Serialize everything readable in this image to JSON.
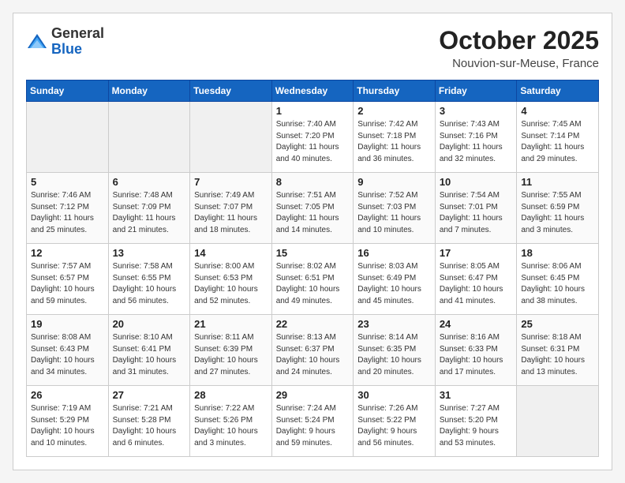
{
  "header": {
    "logo_general": "General",
    "logo_blue": "Blue",
    "month_title": "October 2025",
    "location": "Nouvion-sur-Meuse, France"
  },
  "weekdays": [
    "Sunday",
    "Monday",
    "Tuesday",
    "Wednesday",
    "Thursday",
    "Friday",
    "Saturday"
  ],
  "weeks": [
    [
      {
        "day": "",
        "info": ""
      },
      {
        "day": "",
        "info": ""
      },
      {
        "day": "",
        "info": ""
      },
      {
        "day": "1",
        "info": "Sunrise: 7:40 AM\nSunset: 7:20 PM\nDaylight: 11 hours\nand 40 minutes."
      },
      {
        "day": "2",
        "info": "Sunrise: 7:42 AM\nSunset: 7:18 PM\nDaylight: 11 hours\nand 36 minutes."
      },
      {
        "day": "3",
        "info": "Sunrise: 7:43 AM\nSunset: 7:16 PM\nDaylight: 11 hours\nand 32 minutes."
      },
      {
        "day": "4",
        "info": "Sunrise: 7:45 AM\nSunset: 7:14 PM\nDaylight: 11 hours\nand 29 minutes."
      }
    ],
    [
      {
        "day": "5",
        "info": "Sunrise: 7:46 AM\nSunset: 7:12 PM\nDaylight: 11 hours\nand 25 minutes."
      },
      {
        "day": "6",
        "info": "Sunrise: 7:48 AM\nSunset: 7:09 PM\nDaylight: 11 hours\nand 21 minutes."
      },
      {
        "day": "7",
        "info": "Sunrise: 7:49 AM\nSunset: 7:07 PM\nDaylight: 11 hours\nand 18 minutes."
      },
      {
        "day": "8",
        "info": "Sunrise: 7:51 AM\nSunset: 7:05 PM\nDaylight: 11 hours\nand 14 minutes."
      },
      {
        "day": "9",
        "info": "Sunrise: 7:52 AM\nSunset: 7:03 PM\nDaylight: 11 hours\nand 10 minutes."
      },
      {
        "day": "10",
        "info": "Sunrise: 7:54 AM\nSunset: 7:01 PM\nDaylight: 11 hours\nand 7 minutes."
      },
      {
        "day": "11",
        "info": "Sunrise: 7:55 AM\nSunset: 6:59 PM\nDaylight: 11 hours\nand 3 minutes."
      }
    ],
    [
      {
        "day": "12",
        "info": "Sunrise: 7:57 AM\nSunset: 6:57 PM\nDaylight: 10 hours\nand 59 minutes."
      },
      {
        "day": "13",
        "info": "Sunrise: 7:58 AM\nSunset: 6:55 PM\nDaylight: 10 hours\nand 56 minutes."
      },
      {
        "day": "14",
        "info": "Sunrise: 8:00 AM\nSunset: 6:53 PM\nDaylight: 10 hours\nand 52 minutes."
      },
      {
        "day": "15",
        "info": "Sunrise: 8:02 AM\nSunset: 6:51 PM\nDaylight: 10 hours\nand 49 minutes."
      },
      {
        "day": "16",
        "info": "Sunrise: 8:03 AM\nSunset: 6:49 PM\nDaylight: 10 hours\nand 45 minutes."
      },
      {
        "day": "17",
        "info": "Sunrise: 8:05 AM\nSunset: 6:47 PM\nDaylight: 10 hours\nand 41 minutes."
      },
      {
        "day": "18",
        "info": "Sunrise: 8:06 AM\nSunset: 6:45 PM\nDaylight: 10 hours\nand 38 minutes."
      }
    ],
    [
      {
        "day": "19",
        "info": "Sunrise: 8:08 AM\nSunset: 6:43 PM\nDaylight: 10 hours\nand 34 minutes."
      },
      {
        "day": "20",
        "info": "Sunrise: 8:10 AM\nSunset: 6:41 PM\nDaylight: 10 hours\nand 31 minutes."
      },
      {
        "day": "21",
        "info": "Sunrise: 8:11 AM\nSunset: 6:39 PM\nDaylight: 10 hours\nand 27 minutes."
      },
      {
        "day": "22",
        "info": "Sunrise: 8:13 AM\nSunset: 6:37 PM\nDaylight: 10 hours\nand 24 minutes."
      },
      {
        "day": "23",
        "info": "Sunrise: 8:14 AM\nSunset: 6:35 PM\nDaylight: 10 hours\nand 20 minutes."
      },
      {
        "day": "24",
        "info": "Sunrise: 8:16 AM\nSunset: 6:33 PM\nDaylight: 10 hours\nand 17 minutes."
      },
      {
        "day": "25",
        "info": "Sunrise: 8:18 AM\nSunset: 6:31 PM\nDaylight: 10 hours\nand 13 minutes."
      }
    ],
    [
      {
        "day": "26",
        "info": "Sunrise: 7:19 AM\nSunset: 5:29 PM\nDaylight: 10 hours\nand 10 minutes."
      },
      {
        "day": "27",
        "info": "Sunrise: 7:21 AM\nSunset: 5:28 PM\nDaylight: 10 hours\nand 6 minutes."
      },
      {
        "day": "28",
        "info": "Sunrise: 7:22 AM\nSunset: 5:26 PM\nDaylight: 10 hours\nand 3 minutes."
      },
      {
        "day": "29",
        "info": "Sunrise: 7:24 AM\nSunset: 5:24 PM\nDaylight: 9 hours\nand 59 minutes."
      },
      {
        "day": "30",
        "info": "Sunrise: 7:26 AM\nSunset: 5:22 PM\nDaylight: 9 hours\nand 56 minutes."
      },
      {
        "day": "31",
        "info": "Sunrise: 7:27 AM\nSunset: 5:20 PM\nDaylight: 9 hours\nand 53 minutes."
      },
      {
        "day": "",
        "info": ""
      }
    ]
  ]
}
